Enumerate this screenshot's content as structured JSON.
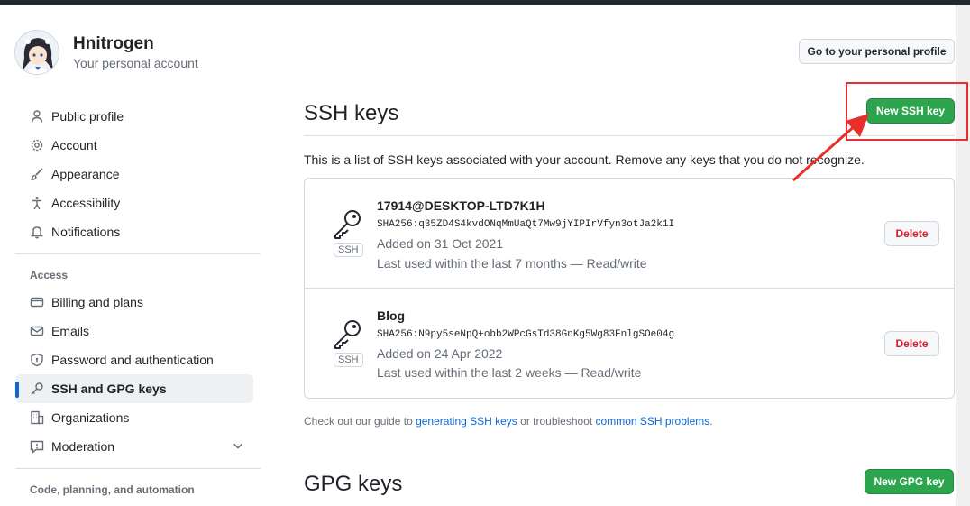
{
  "account": {
    "username": "Hnitrogen",
    "subtitle": "Your personal account",
    "profile_button": "Go to your personal profile"
  },
  "sidebar": {
    "items": [
      {
        "label": "Public profile",
        "icon": "person-icon"
      },
      {
        "label": "Account",
        "icon": "gear-icon"
      },
      {
        "label": "Appearance",
        "icon": "paintbrush-icon"
      },
      {
        "label": "Accessibility",
        "icon": "accessibility-icon"
      },
      {
        "label": "Notifications",
        "icon": "bell-icon"
      }
    ],
    "access_heading": "Access",
    "access_items": [
      {
        "label": "Billing and plans",
        "icon": "credit-card-icon"
      },
      {
        "label": "Emails",
        "icon": "mail-icon"
      },
      {
        "label": "Password and authentication",
        "icon": "shield-lock-icon"
      },
      {
        "label": "SSH and GPG keys",
        "icon": "key-icon",
        "active": true
      },
      {
        "label": "Organizations",
        "icon": "organization-icon"
      },
      {
        "label": "Moderation",
        "icon": "report-icon"
      }
    ],
    "code_heading": "Code, planning, and automation"
  },
  "ssh": {
    "title": "SSH keys",
    "new_button": "New SSH key",
    "intro": "This is a list of SSH keys associated with your account. Remove any keys that you do not recognize.",
    "badge": "SSH",
    "delete_label": "Delete",
    "keys": [
      {
        "title": "17914@DESKTOP-LTD7K1H",
        "fingerprint": "SHA256:q35ZD4S4kvdONqMmUaQt7Mw9jYIPIrVfyn3otJa2k1I",
        "added": "Added on 31 Oct 2021",
        "last_used": "Last used within the last 7 months — Read/write"
      },
      {
        "title": "Blog",
        "fingerprint": "SHA256:N9py5seNpQ+obb2WPcGsTd38GnKg5Wg83FnlgSOe04g",
        "added": "Added on 24 Apr 2022",
        "last_used": "Last used within the last 2 weeks — Read/write"
      }
    ],
    "guide_prefix": "Check out our guide to ",
    "guide_link1": "generating SSH keys",
    "guide_middle": " or troubleshoot ",
    "guide_link2": "common SSH problems",
    "guide_suffix": "."
  },
  "gpg": {
    "title": "GPG keys",
    "new_button": "New GPG key"
  },
  "colors": {
    "primary": "#2da44e",
    "danger": "#cf222e",
    "link": "#0969da",
    "annotation": "#e8302a"
  }
}
